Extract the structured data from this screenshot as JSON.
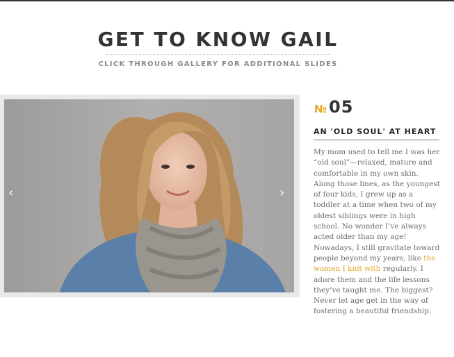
{
  "header": {
    "title": "GET TO KNOW GAIL",
    "subtitle": "CLICK THROUGH GALLERY FOR ADDITIONAL SLIDES"
  },
  "gallery": {
    "prev_icon": "chevron-left-icon",
    "next_icon": "chevron-right-icon",
    "prev_glyph": "‹",
    "next_glyph": "›",
    "photo": "portrait-photo"
  },
  "slide": {
    "number_sign": "№",
    "number": "05",
    "heading": "AN 'OLD SOUL' AT HEART",
    "body_before": "My mom used to tell me I was her “old soul”—relaxed, mature and comfortable in my own skin. Along those lines, as the youngest of four kids, I grew up as a toddler at a time when two of my oldest siblings were in high school. No wonder I’ve always acted older than my age! Nowadays, I still gravitate toward people beyond my years, like ",
    "link_text": "the women I knit with",
    "body_after": " regularly. I adore them and the life lessons they’ve taught me. The biggest? Never let age get in the way of fostering a beautiful friendship."
  },
  "colors": {
    "accent": "#e7a520",
    "title": "#333333",
    "body": "#6b6b6b"
  }
}
